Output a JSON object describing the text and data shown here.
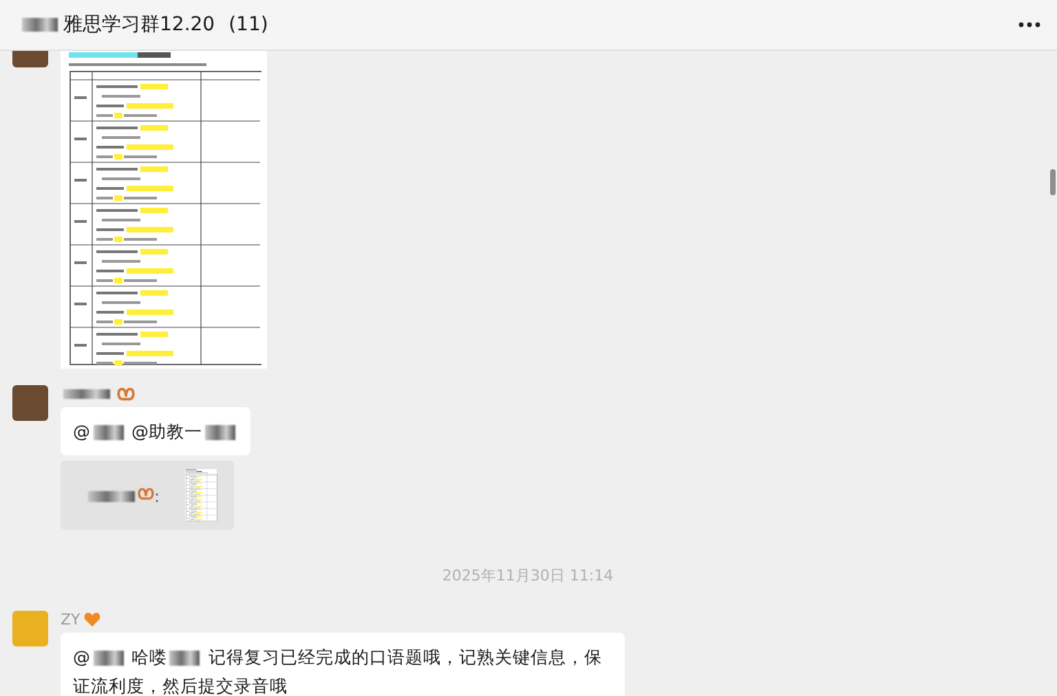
{
  "header": {
    "title_parts": [
      {
        "kind": "redacted"
      },
      {
        "kind": "text",
        "text": "雅思学习群12.20"
      }
    ],
    "count": "(11)"
  },
  "messages": [
    {
      "kind": "image",
      "color": "#6b4a32"
    },
    {
      "kind": "text",
      "color": "#6b4a32",
      "sender": [
        {
          "kind": "redacted"
        },
        {
          "kind": "pretzel"
        }
      ],
      "parts": [
        {
          "kind": "text",
          "text": "@"
        },
        {
          "kind": "redacted"
        },
        {
          "kind": "text",
          "text": " @助教一"
        },
        {
          "kind": "redacted"
        }
      ],
      "quote": {
        "parts": [
          {
            "kind": "redacted"
          },
          {
            "kind": "pretzel"
          },
          {
            "kind": "text",
            "text": ":"
          }
        ]
      }
    },
    {
      "kind": "time",
      "text": "2025年11月30日 11:14"
    },
    {
      "kind": "text",
      "color": "#e9b020",
      "sender": [
        {
          "kind": "text",
          "text": "ZY"
        },
        {
          "kind": "heart"
        }
      ],
      "parts": [
        {
          "kind": "text",
          "text": "@"
        },
        {
          "kind": "redacted"
        },
        {
          "kind": "text",
          "text": " 哈喽"
        },
        {
          "kind": "redacted"
        },
        {
          "kind": "text",
          "text": "  记得复习已经完成的口语题哦，记熟关键信息，保证流利度，然后提交录音哦"
        }
      ]
    }
  ]
}
